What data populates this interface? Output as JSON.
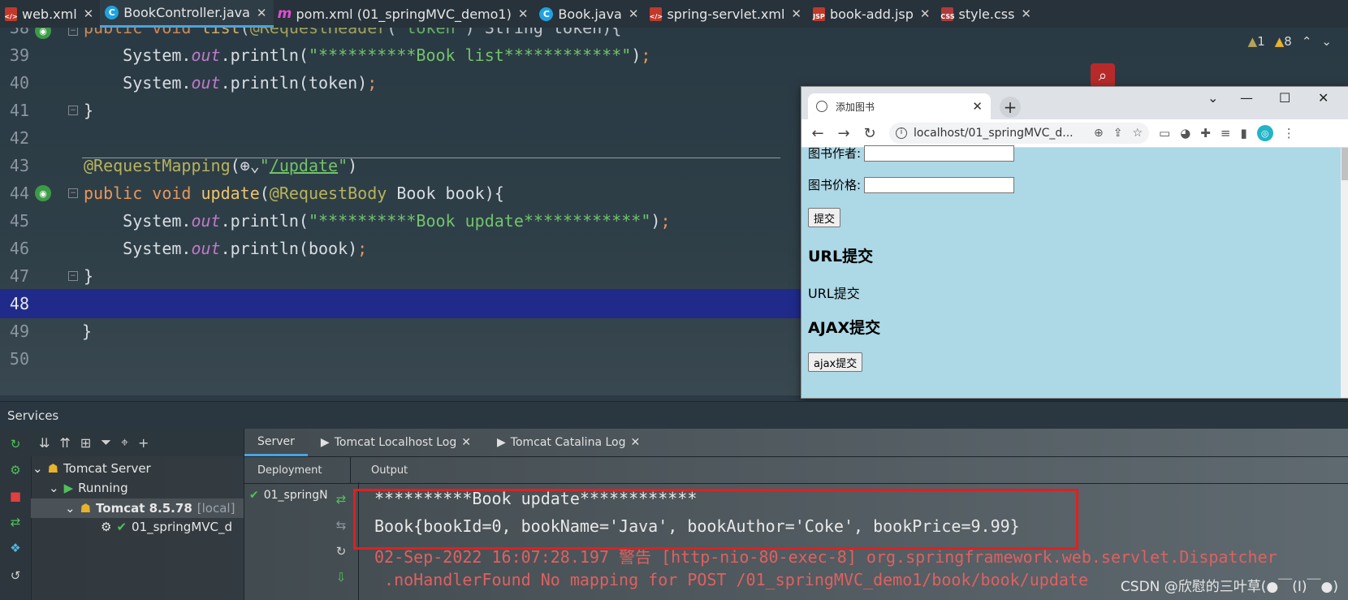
{
  "tabs": [
    {
      "icon": "xml",
      "label": "web.xml"
    },
    {
      "icon": "class",
      "label": "BookController.java",
      "active": true
    },
    {
      "icon": "maven",
      "label": "pom.xml (01_springMVC_demo1)"
    },
    {
      "icon": "class",
      "label": "Book.java"
    },
    {
      "icon": "xml",
      "label": "spring-servlet.xml"
    },
    {
      "icon": "jsp",
      "label": "book-add.jsp"
    },
    {
      "icon": "css",
      "label": "style.css"
    }
  ],
  "editor": {
    "warnings": {
      "weak": "1",
      "warn": "8"
    },
    "lines": [
      "38",
      "39",
      "40",
      "41",
      "42",
      "43",
      "44",
      "45",
      "46",
      "47",
      "48",
      "49",
      "50"
    ]
  },
  "browser": {
    "tab_title": "添加图书",
    "url": "localhost/01_springMVC_d...",
    "author_label": "图书作者:",
    "price_label": "图书价格:",
    "submit_label": "提交",
    "url_heading": "URL提交",
    "url_link": "URL提交",
    "ajax_heading": "AJAX提交",
    "ajax_button": "ajax提交"
  },
  "services": {
    "title": "Services",
    "tree": {
      "server": "Tomcat Server",
      "running": "Running",
      "tomcat": "Tomcat 8.5.78",
      "tomcat_suffix": "[local]",
      "artifact": "01_springMVC_d"
    },
    "sub_tabs": [
      "Server",
      "Tomcat Localhost Log",
      "Tomcat Catalina Log"
    ],
    "col_deployment": "Deployment",
    "col_output": "Output",
    "deploy_item": "01_springN",
    "output": [
      "**********Book update************",
      "Book{bookId=0, bookName='Java', bookAuthor='Coke', bookPrice=9.99}",
      "02-Sep-2022 16:07:28.197 警告 [http-nio-80-exec-8] org.springframework.web.servlet.Dispatcher",
      " .noHandlerFound No mapping for POST /01_springMVC_demo1/book/book/update"
    ]
  },
  "watermark": "CSDN @欣慰的三叶草(●￣(I)￣●)"
}
